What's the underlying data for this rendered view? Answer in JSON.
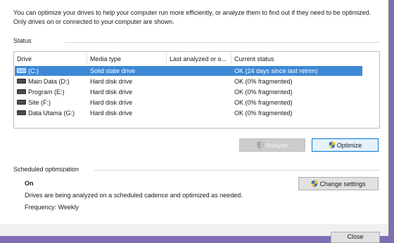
{
  "intro_text": "You can optimize your drives to help your computer run more efficiently, or analyze them to find out if they need to be optimized. Only drives on or connected to your computer are shown.",
  "status": {
    "section_label": "Status",
    "columns": [
      "Drive",
      "Media type",
      "Last analyzed or o...",
      "Current status"
    ],
    "drives": [
      {
        "drive": "(C:)",
        "media": "Solid state drive",
        "last": "",
        "status": "OK (24 days since last retrim)",
        "selected": true
      },
      {
        "drive": "Main Data (D:)",
        "media": "Hard disk drive",
        "last": "",
        "status": "OK (0% fragmented)",
        "selected": false
      },
      {
        "drive": "Program (E:)",
        "media": "Hard disk drive",
        "last": "",
        "status": "OK (0% fragmented)",
        "selected": false
      },
      {
        "drive": "Site (F:)",
        "media": "Hard disk drive",
        "last": "",
        "status": "OK (0% fragmented)",
        "selected": false
      },
      {
        "drive": "Data Utama (G:)",
        "media": "Hard disk drive",
        "last": "",
        "status": "OK (0% fragmented)",
        "selected": false
      }
    ],
    "analyze_label": "Analyze",
    "optimize_label": "Optimize"
  },
  "scheduled": {
    "section_label": "Scheduled optimization",
    "state": "On",
    "description": "Drives are being analyzed on a scheduled cadence and optimized as needed.",
    "frequency": "Frequency: Weekly",
    "change_settings_label": "Change settings"
  },
  "footer": {
    "close_label": "Close"
  },
  "colors": {
    "selection": "#3d88d6",
    "background": "#7f6fb2"
  }
}
